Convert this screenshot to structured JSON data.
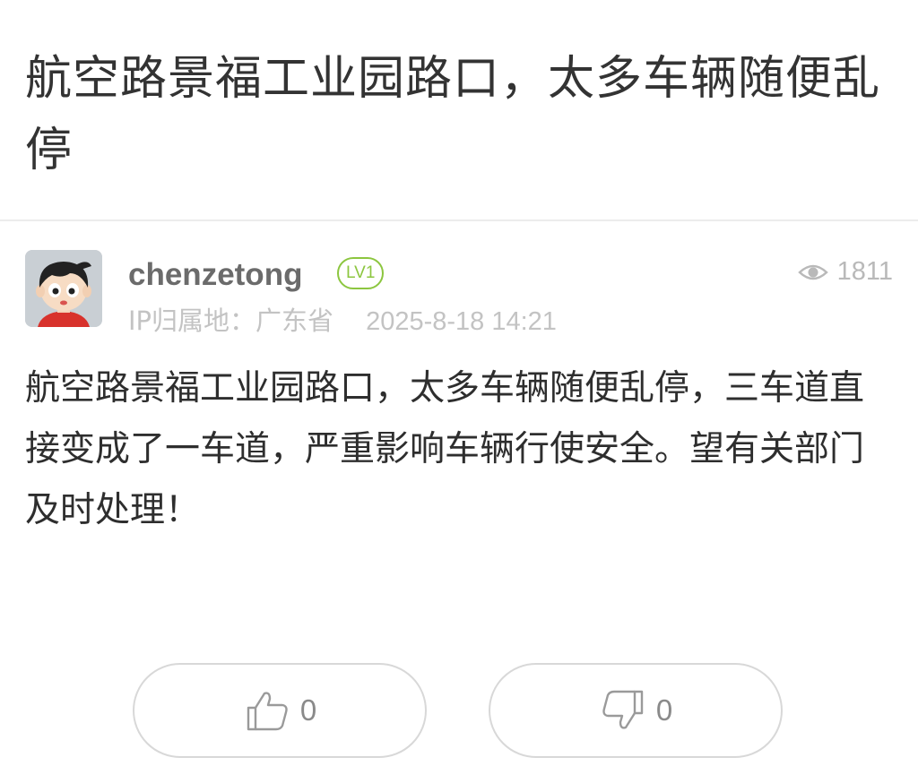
{
  "post": {
    "title": "航空路景福工业园路口，太多车辆随便乱停",
    "content": "航空路景福工业园路口，太多车辆随便乱停，三车道直接变成了一车道，严重影响车辆行使安全。望有关部门及时处理！"
  },
  "author": {
    "username": "chenzetong",
    "level": "LV1",
    "ip_label": "IP归属地：",
    "ip_location": "广东省",
    "date": "2025-8-18 14:21",
    "avatar_icon": "cartoon-boy-avatar"
  },
  "stats": {
    "views": "1811",
    "view_icon": "eye-icon"
  },
  "actions": {
    "like_count": "0",
    "dislike_count": "0",
    "like_icon": "thumbs-up-icon",
    "dislike_icon": "thumbs-down-icon"
  },
  "colors": {
    "level_badge": "#8cc63f",
    "muted_text": "#c3c3c3",
    "divider": "#ececec"
  }
}
